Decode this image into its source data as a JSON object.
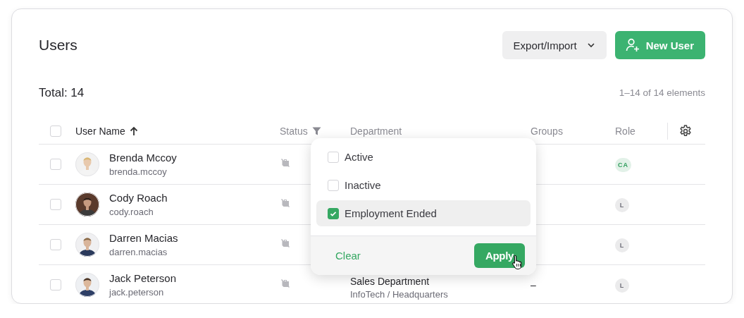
{
  "header": {
    "title": "Users",
    "buttons": [
      {
        "label": "Export/Import",
        "kind": "menu"
      },
      {
        "label": "New User",
        "kind": "primary"
      }
    ]
  },
  "summary": {
    "total": "Total: 14",
    "range": "1–14 of 14 elements"
  },
  "table": {
    "select_all": {
      "checked": false
    },
    "columns": [
      {
        "label": "User Name",
        "kind": "sort"
      },
      {
        "label": "Status",
        "kind": "filter"
      },
      {
        "label": "Department",
        "kind": "plain"
      },
      {
        "label": "Groups",
        "kind": "plain"
      },
      {
        "label": "Role",
        "kind": "plain"
      }
    ],
    "rows": [
      {
        "checked": false,
        "name": "Brenda Mccoy",
        "login": "brenda.mccoy",
        "role": "CA",
        "color": "#2f9d5c"
      },
      {
        "checked": false,
        "name": "Cody Roach",
        "login": "cody.roach",
        "role": "L",
        "color": "#6e6e78"
      },
      {
        "checked": false,
        "name": "Darren Macias",
        "login": "darren.macias",
        "role": "L",
        "color": "#6e6e78"
      },
      {
        "checked": false,
        "name": "Jack Peterson",
        "login": "jack.peterson",
        "department": "Sales Department",
        "location": "InfoTech / Headquarters",
        "groups": "–",
        "role": "L",
        "color": "#6e6e78"
      }
    ]
  },
  "status_filter": {
    "options": [
      {
        "label": "Active",
        "checked": false,
        "selected": false
      },
      {
        "label": "Inactive",
        "checked": false,
        "selected": false
      },
      {
        "label": "Employment Ended",
        "checked": true,
        "selected": true
      }
    ],
    "clear": "Clear",
    "apply": "Apply"
  }
}
